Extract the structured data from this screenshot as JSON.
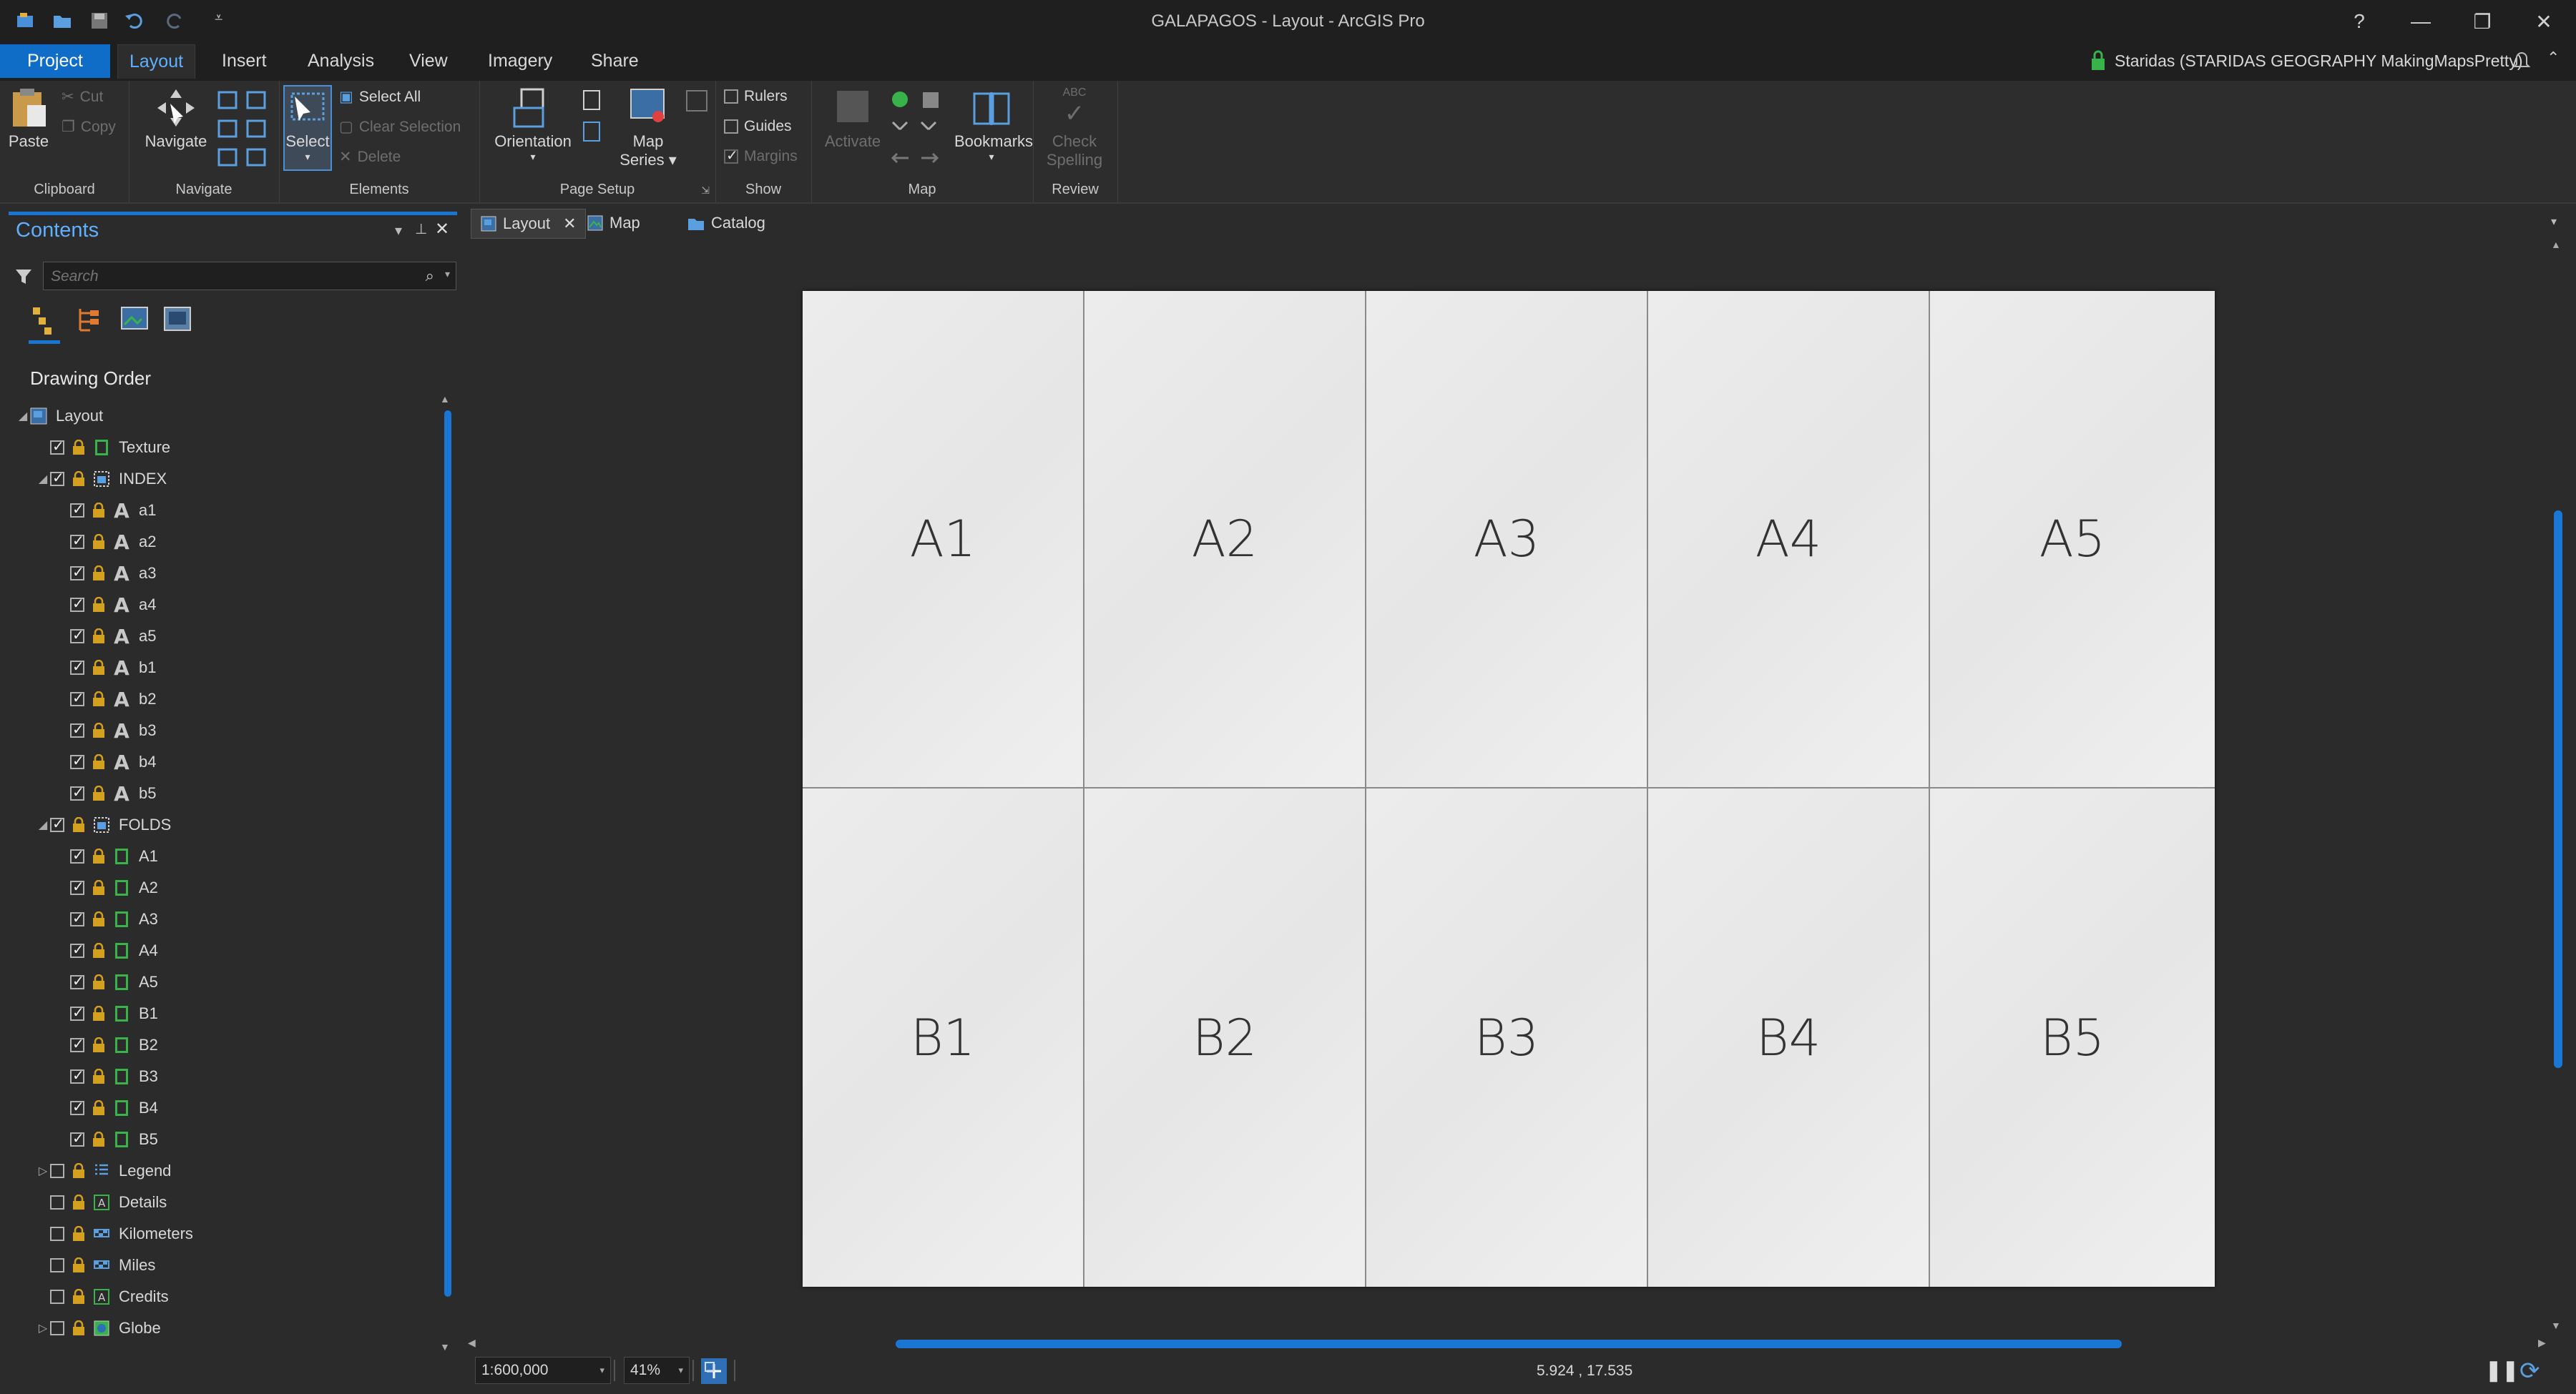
{
  "window": {
    "title": "GALAPAGOS - Layout - ArcGIS Pro",
    "help": "?",
    "minimize": "—",
    "restore": "❐",
    "close": "✕"
  },
  "ribbon_tabs": [
    "Project",
    "Layout",
    "Insert",
    "Analysis",
    "View",
    "Imagery",
    "Share"
  ],
  "account": "Staridas (STARIDAS GEOGRAPHY MakingMapsPretty)",
  "ribbon": {
    "clipboard": {
      "paste": "Paste",
      "cut": "Cut",
      "copy": "Copy",
      "label": "Clipboard"
    },
    "navigate": {
      "navigate": "Navigate",
      "label": "Navigate"
    },
    "elements": {
      "select": "Select",
      "select_all": "Select All",
      "clear_selection": "Clear Selection",
      "delete": "Delete",
      "label": "Elements"
    },
    "page_setup": {
      "orientation": "Orientation",
      "map_series_1": "Map",
      "map_series_2": "Series",
      "label": "Page Setup"
    },
    "show": {
      "rulers": "Rulers",
      "guides": "Guides",
      "margins": "Margins",
      "label": "Show"
    },
    "map": {
      "activate": "Activate",
      "bookmarks": "Bookmarks",
      "label": "Map"
    },
    "review": {
      "check_1": "Check",
      "check_2": "Spelling",
      "abc": "ABC",
      "label": "Review"
    }
  },
  "contents": {
    "title": "Contents",
    "search_placeholder": "Search",
    "drawing_order": "Drawing Order",
    "rows": [
      {
        "label": "Layout",
        "indent": 0,
        "tri": "◢",
        "cb": null,
        "lock": false,
        "icon": "layout"
      },
      {
        "label": "Texture",
        "indent": 1,
        "tri": "",
        "cb": true,
        "lock": true,
        "icon": "rect"
      },
      {
        "label": "INDEX",
        "indent": 1,
        "tri": "◢",
        "cb": true,
        "lock": true,
        "icon": "group"
      },
      {
        "label": "a1",
        "indent": 2,
        "tri": "",
        "cb": true,
        "lock": true,
        "icon": "text"
      },
      {
        "label": "a2",
        "indent": 2,
        "tri": "",
        "cb": true,
        "lock": true,
        "icon": "text"
      },
      {
        "label": "a3",
        "indent": 2,
        "tri": "",
        "cb": true,
        "lock": true,
        "icon": "text"
      },
      {
        "label": "a4",
        "indent": 2,
        "tri": "",
        "cb": true,
        "lock": true,
        "icon": "text"
      },
      {
        "label": "a5",
        "indent": 2,
        "tri": "",
        "cb": true,
        "lock": true,
        "icon": "text"
      },
      {
        "label": "b1",
        "indent": 2,
        "tri": "",
        "cb": true,
        "lock": true,
        "icon": "text"
      },
      {
        "label": "b2",
        "indent": 2,
        "tri": "",
        "cb": true,
        "lock": true,
        "icon": "text"
      },
      {
        "label": "b3",
        "indent": 2,
        "tri": "",
        "cb": true,
        "lock": true,
        "icon": "text"
      },
      {
        "label": "b4",
        "indent": 2,
        "tri": "",
        "cb": true,
        "lock": true,
        "icon": "text"
      },
      {
        "label": "b5",
        "indent": 2,
        "tri": "",
        "cb": true,
        "lock": true,
        "icon": "text"
      },
      {
        "label": "FOLDS",
        "indent": 1,
        "tri": "◢",
        "cb": true,
        "lock": true,
        "icon": "group"
      },
      {
        "label": "A1",
        "indent": 2,
        "tri": "",
        "cb": true,
        "lock": true,
        "icon": "rect"
      },
      {
        "label": "A2",
        "indent": 2,
        "tri": "",
        "cb": true,
        "lock": true,
        "icon": "rect"
      },
      {
        "label": "A3",
        "indent": 2,
        "tri": "",
        "cb": true,
        "lock": true,
        "icon": "rect"
      },
      {
        "label": "A4",
        "indent": 2,
        "tri": "",
        "cb": true,
        "lock": true,
        "icon": "rect"
      },
      {
        "label": "A5",
        "indent": 2,
        "tri": "",
        "cb": true,
        "lock": true,
        "icon": "rect"
      },
      {
        "label": "B1",
        "indent": 2,
        "tri": "",
        "cb": true,
        "lock": true,
        "icon": "rect"
      },
      {
        "label": "B2",
        "indent": 2,
        "tri": "",
        "cb": true,
        "lock": true,
        "icon": "rect"
      },
      {
        "label": "B3",
        "indent": 2,
        "tri": "",
        "cb": true,
        "lock": true,
        "icon": "rect"
      },
      {
        "label": "B4",
        "indent": 2,
        "tri": "",
        "cb": true,
        "lock": true,
        "icon": "rect"
      },
      {
        "label": "B5",
        "indent": 2,
        "tri": "",
        "cb": true,
        "lock": true,
        "icon": "rect"
      },
      {
        "label": "Legend",
        "indent": 1,
        "tri": "▷",
        "cb": false,
        "lock": true,
        "icon": "legend"
      },
      {
        "label": "Details",
        "indent": 1,
        "tri": "",
        "cb": false,
        "lock": true,
        "icon": "textframe"
      },
      {
        "label": "Kilometers",
        "indent": 1,
        "tri": "",
        "cb": false,
        "lock": true,
        "icon": "scalebar"
      },
      {
        "label": "Miles",
        "indent": 1,
        "tri": "",
        "cb": false,
        "lock": true,
        "icon": "scalebar"
      },
      {
        "label": "Credits",
        "indent": 1,
        "tri": "",
        "cb": false,
        "lock": true,
        "icon": "textframe"
      },
      {
        "label": "Globe",
        "indent": 1,
        "tri": "▷",
        "cb": false,
        "lock": true,
        "icon": "mapframe"
      }
    ]
  },
  "doc_tabs": [
    {
      "label": "Layout",
      "active": true
    },
    {
      "label": "Map",
      "active": false
    },
    {
      "label": "Catalog",
      "active": false
    }
  ],
  "page_cells": {
    "row_a": [
      "A1",
      "A2",
      "A3",
      "A4",
      "A5"
    ],
    "row_b": [
      "B1",
      "B2",
      "B3",
      "B4",
      "B5"
    ]
  },
  "status": {
    "scale": "1:600,000",
    "zoom": "41%",
    "coordinates": "5.924 , 17.535"
  },
  "colors": {
    "accent": "#1976d2",
    "project_tab": "#0f6cc7",
    "active_tab_text": "#5fb0ff",
    "layer_green": "#37b34a"
  }
}
